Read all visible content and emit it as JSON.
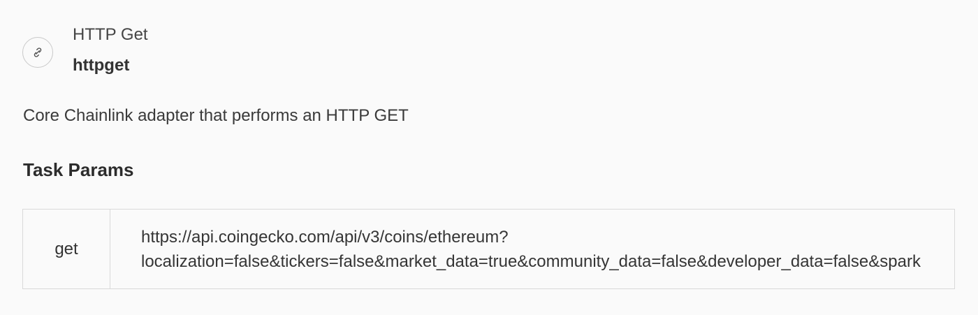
{
  "task": {
    "name": "HTTP Get",
    "type": "httpget",
    "icon": "link-icon",
    "description": "Core Chainlink adapter that performs an HTTP GET"
  },
  "task_params": {
    "section_title": "Task Params",
    "rows": [
      {
        "key": "get",
        "value_lines": [
          "https://api.coingecko.com/api/v3/coins/ethereum?",
          "localization=false&tickers=false&market_data=true&community_data=false&developer_data=false&spark"
        ]
      }
    ]
  }
}
